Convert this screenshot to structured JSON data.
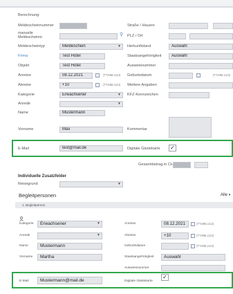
{
  "header": {
    "berechnung": "Berechnung:"
  },
  "form": {
    "meldescheinnummer": "Meldescheinnummer",
    "manuelle": "manuelle Meldescheinnr.",
    "meldescheintyp": "Meldescheintyp",
    "meldescheintyp_val": "Meldeschein",
    "firma": "Firma",
    "firma_val": "Test Hotel",
    "objekt": "Objekt",
    "objekt_val": "Test Hotel",
    "anreise": "Anreise",
    "anreise_val": "08.12.2021",
    "abreise": "Abreise",
    "abreise_val": "+10",
    "date_fmt": "(TT.MM.JJJJ)",
    "kategorie": "Kategorie",
    "kategorie_val": "Erwachsener",
    "anrede": "Anrede",
    "name": "Name",
    "name_val": "Mustermann",
    "vorname": "Vorname",
    "vorname_val": "Max",
    "email": "E-Mail",
    "email_val": "test@mail.de",
    "strasse": "Straße / Hausnr.",
    "plz": "PLZ / Ort",
    "herkunftsland": "Herkunftsland",
    "herkunftsland_val": "Auswahl",
    "staatsangehoerigkeit": "Staatsangehörigkeit",
    "staatsangehoerigkeit_val": "Auswahl",
    "ausweisnummer": "Ausweisnummer",
    "geburtsdatum": "Geburtsdatum",
    "weitere": "Weitere Angaben",
    "kfz": "KFZ-Kennzeichen",
    "kommentar": "Kommentar",
    "digitale": "Digitale Gästekarte",
    "gesamtbetrag": "Gesamtbetrag in CHF"
  },
  "zusatz": {
    "title": "Individuelle Zusatzfelder",
    "reisegrund": "Reisegrund"
  },
  "begleit": {
    "title": "Begleitpersonen",
    "alle": "Alle",
    "row_title": "1. Begleitperson",
    "kategorie": "Kategorie",
    "kategorie_val": "Erwachsener",
    "anrede": "Anrede",
    "name": "Name",
    "name_val": "Mustermann",
    "vorname": "Vorname",
    "vorname_val": "Martha",
    "email": "E-Mail",
    "email_val": "Mustermann@mail.de",
    "anreise": "Anreise",
    "anreise_val": "08.12.2021",
    "abreise": "Abreise",
    "abreise_val": "+10",
    "date_fmt": "(TT.MM.JJJJ)",
    "geburtsdatum": "Geburtsdatum",
    "staatsangehoerigkeit": "Staatsangehörigkeit",
    "staatsangehoerigkeit_val": "Auswahl",
    "ausweisnummer": "Ausweisnummer",
    "digitale": "Digitale Gästekarte"
  },
  "icons": {
    "checkmark": "✓",
    "search": "🔍",
    "dropdown": "▼",
    "person": "person-add-icon"
  },
  "colors": {
    "highlight": "#2fa64a",
    "label_blue": "#4a84c4",
    "field": "#e4e6ea"
  }
}
